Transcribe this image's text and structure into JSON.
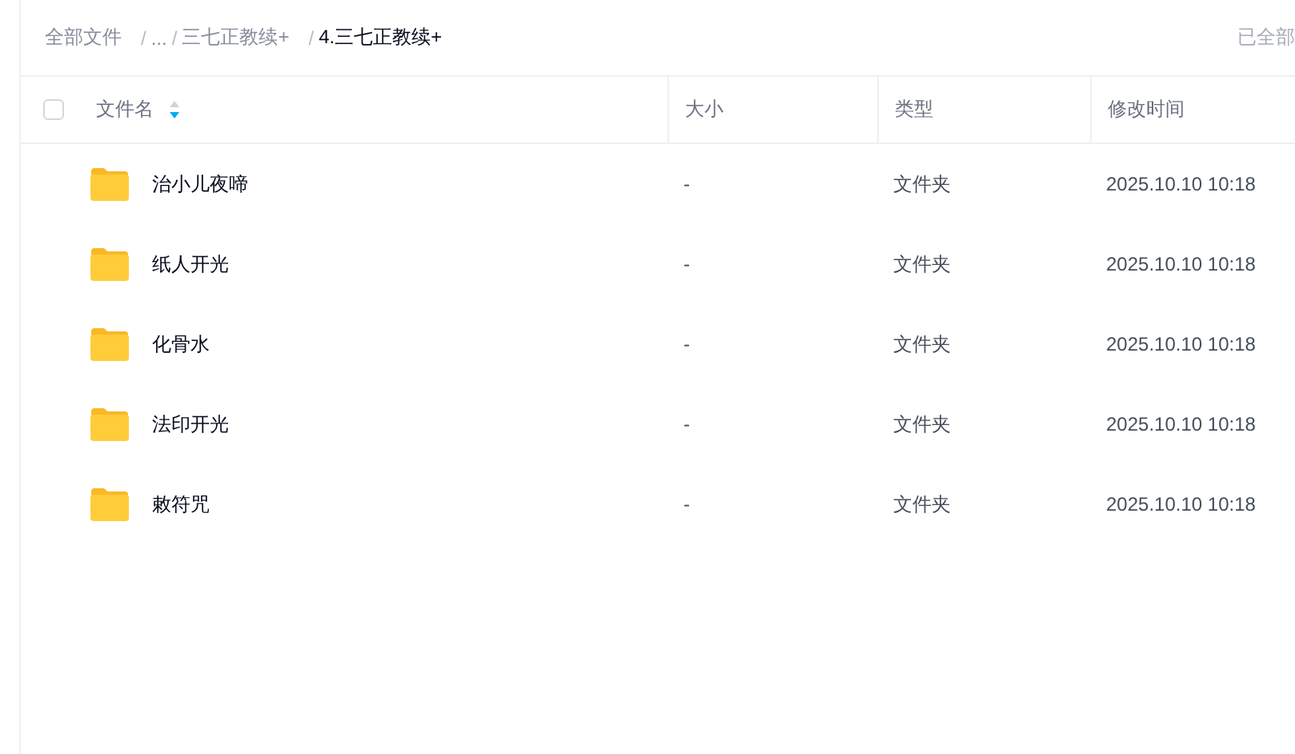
{
  "breadcrumb": {
    "items": [
      {
        "label": "全部文件",
        "current": false
      },
      {
        "separator": "/",
        "label": "...",
        "current": false
      },
      {
        "separator": "/",
        "label": "三七正教续+",
        "current": false
      },
      {
        "separator": "/",
        "label": "4.三七正教续+",
        "current": true
      }
    ]
  },
  "status": "已全部",
  "table": {
    "select_all": {
      "checked": false
    },
    "columns": [
      {
        "label": "文件名",
        "sortable": true
      },
      {
        "label": "大小",
        "sortable": false
      },
      {
        "label": "类型",
        "sortable": false
      },
      {
        "label": "修改时间",
        "sortable": false
      }
    ],
    "rows": [
      {
        "name": "治小儿夜啼",
        "size": "-",
        "type": "文件夹",
        "modified": "2025.10.10 10:18"
      },
      {
        "name": "纸人开光",
        "size": "-",
        "type": "文件夹",
        "modified": "2025.10.10 10:18"
      },
      {
        "name": "化骨水",
        "size": "-",
        "type": "文件夹",
        "modified": "2025.10.10 10:18"
      },
      {
        "name": "法印开光",
        "size": "-",
        "type": "文件夹",
        "modified": "2025.10.10 10:18"
      },
      {
        "name": "敕符咒",
        "size": "-",
        "type": "文件夹",
        "modified": "2025.10.10 10:18"
      }
    ]
  }
}
